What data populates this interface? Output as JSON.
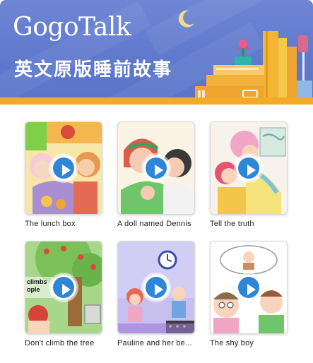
{
  "header": {
    "logo": "GogoTalk",
    "subtitle": "英文原版睡前故事"
  },
  "colors": {
    "banner": "#5f79cd",
    "divider": "#f3a92a",
    "play_button": "#2d86d8"
  },
  "stories": [
    {
      "title": "The lunch box"
    },
    {
      "title": "A doll named Dennis"
    },
    {
      "title": "Tell the truth"
    },
    {
      "title": "Don't climb the tree",
      "art_text": "climbs\nople"
    },
    {
      "title": "Pauline and her be..."
    },
    {
      "title": "The shy boy"
    }
  ]
}
